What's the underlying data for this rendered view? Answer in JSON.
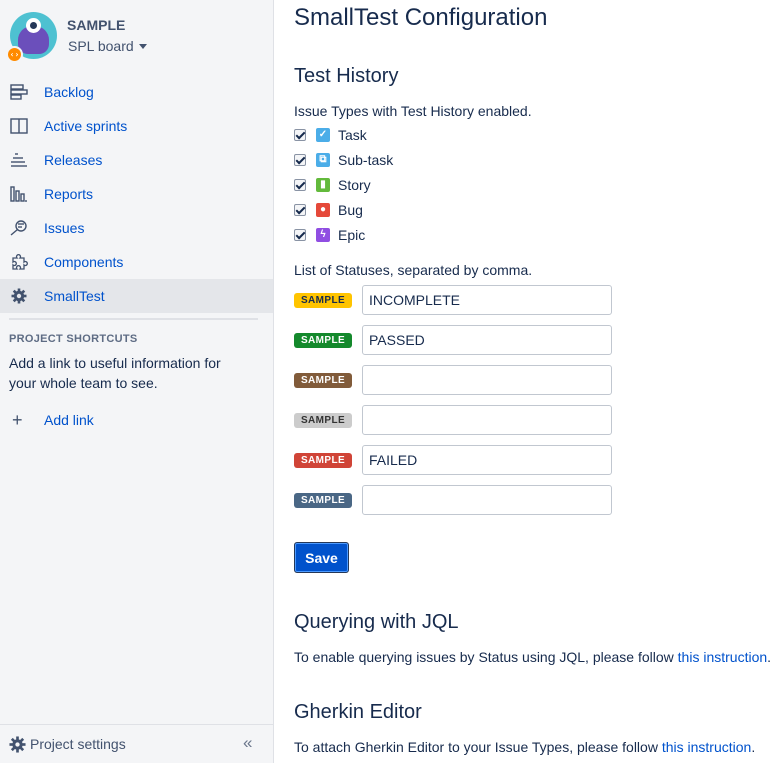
{
  "project": {
    "name": "SAMPLE",
    "board": "SPL board"
  },
  "nav": {
    "items": [
      {
        "label": "Backlog",
        "icon": "backlog-icon"
      },
      {
        "label": "Active sprints",
        "icon": "active-sprints-icon"
      },
      {
        "label": "Releases",
        "icon": "releases-icon"
      },
      {
        "label": "Reports",
        "icon": "reports-icon"
      },
      {
        "label": "Issues",
        "icon": "issues-icon"
      },
      {
        "label": "Components",
        "icon": "components-icon"
      },
      {
        "label": "SmallTest",
        "icon": "gear-icon",
        "active": true
      }
    ]
  },
  "shortcuts": {
    "title": "PROJECT SHORTCUTS",
    "description": "Add a link to useful information for your whole team to see.",
    "add_link": "Add link"
  },
  "footer": {
    "project_settings": "Project settings",
    "collapse_glyph": "«"
  },
  "main": {
    "title": "SmallTest Configuration",
    "test_history": {
      "heading": "Test History",
      "description": "Issue Types with Test History enabled.",
      "issue_types": [
        {
          "label": "Task",
          "checked": true,
          "color": "#4bade8",
          "glyph": "✓"
        },
        {
          "label": "Sub-task",
          "checked": true,
          "color": "#4bade8",
          "glyph": "⧉"
        },
        {
          "label": "Story",
          "checked": true,
          "color": "#63ba3c",
          "glyph": "▮"
        },
        {
          "label": "Bug",
          "checked": true,
          "color": "#e5493a",
          "glyph": "●"
        },
        {
          "label": "Epic",
          "checked": true,
          "color": "#904ee2",
          "glyph": "ϟ"
        }
      ],
      "statuses_label": "List of Statuses, separated by comma.",
      "statuses": [
        {
          "lozenge": "SAMPLE",
          "bg": "#ffc400",
          "fg": "#172b4d",
          "value": "INCOMPLETE"
        },
        {
          "lozenge": "SAMPLE",
          "bg": "#14892c",
          "fg": "#ffffff",
          "value": "PASSED"
        },
        {
          "lozenge": "SAMPLE",
          "bg": "#815b3a",
          "fg": "#ffffff",
          "value": ""
        },
        {
          "lozenge": "SAMPLE",
          "bg": "#ccccccc",
          "fg": "#333333",
          "value": ""
        },
        {
          "lozenge": "SAMPLE",
          "bg": "#d04437",
          "fg": "#ffffff",
          "value": "FAILED"
        },
        {
          "lozenge": "SAMPLE",
          "bg": "#4a6785",
          "fg": "#ffffff",
          "value": ""
        }
      ],
      "save_label": "Save"
    },
    "jql": {
      "heading": "Querying with JQL",
      "text": "To enable querying issues by Status using JQL, please follow ",
      "link": "this instruction",
      "suffix": "."
    },
    "gherkin": {
      "heading": "Gherkin Editor",
      "text": "To attach Gherkin Editor to your Issue Types, please follow ",
      "link": "this instruction",
      "suffix": "."
    }
  }
}
